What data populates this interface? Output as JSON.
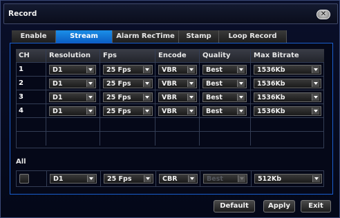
{
  "window": {
    "title": "Record",
    "close_glyph": "✕"
  },
  "tabs": [
    {
      "label": "Enable",
      "active": false
    },
    {
      "label": "Stream",
      "active": true
    },
    {
      "label": "Alarm RecTime",
      "active": false
    },
    {
      "label": "Stamp",
      "active": false
    },
    {
      "label": "Loop Record",
      "active": false
    }
  ],
  "table": {
    "headers": [
      "CH",
      "Resolution",
      "Fps",
      "Encode",
      "Quality",
      "Max Bitrate"
    ],
    "rows": [
      {
        "ch": "1",
        "resolution": "D1",
        "fps": "25 Fps",
        "encode": "VBR",
        "quality": "Best",
        "bitrate": "1536Kb"
      },
      {
        "ch": "2",
        "resolution": "D1",
        "fps": "25 Fps",
        "encode": "VBR",
        "quality": "Best",
        "bitrate": "1536Kb"
      },
      {
        "ch": "3",
        "resolution": "D1",
        "fps": "25 Fps",
        "encode": "VBR",
        "quality": "Best",
        "bitrate": "1536Kb"
      },
      {
        "ch": "4",
        "resolution": "D1",
        "fps": "25 Fps",
        "encode": "VBR",
        "quality": "Best",
        "bitrate": "1536Kb"
      }
    ]
  },
  "all": {
    "label": "All",
    "checked": false,
    "resolution": "D1",
    "fps": "25 Fps",
    "encode": "CBR",
    "quality": "Best",
    "quality_disabled": true,
    "bitrate": "512Kb"
  },
  "buttons": {
    "default": "Default",
    "apply": "Apply",
    "exit": "Exit"
  },
  "colors": {
    "accent": "#0b6fd6",
    "panel_border": "#1a5fd0",
    "background": "#050818"
  }
}
